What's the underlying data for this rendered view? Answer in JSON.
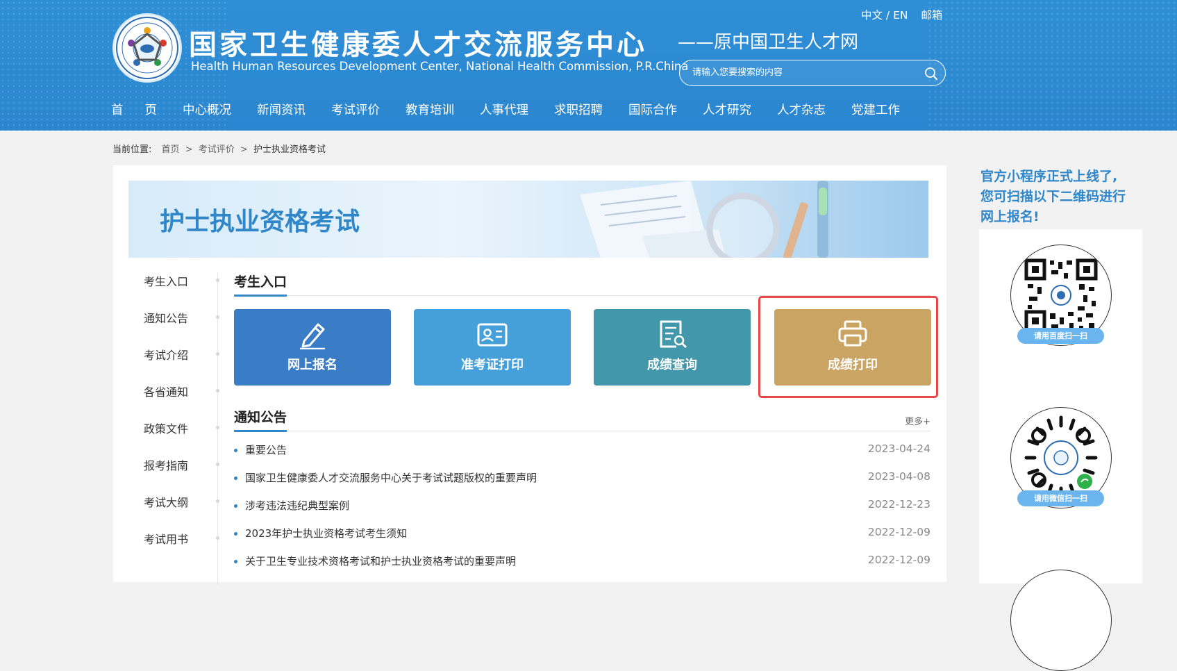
{
  "header": {
    "title": "国家卫生健康委人才交流服务中心",
    "subtitle": "——原中国卫生人才网",
    "english_name": "Health Human Resources Development Center, National Health Commission, P.R.China",
    "lang_switch": "中文 / EN",
    "mail_link": "邮箱",
    "search_placeholder": "请输入您要搜索的内容",
    "icons": {
      "search": "search-icon",
      "logo": "logo-emblem"
    }
  },
  "nav": {
    "items": [
      "首页",
      "中心概况",
      "新闻资讯",
      "考试评价",
      "教育培训",
      "人事代理",
      "求职招聘",
      "国际合作",
      "人才研究",
      "人才杂志",
      "党建工作"
    ]
  },
  "breadcrumb": {
    "label": "当前位置:",
    "items": [
      "首页",
      "考试评价",
      "护士执业资格考试"
    ],
    "separator": ">"
  },
  "banner": {
    "title": "护士执业资格考试"
  },
  "side_menu": {
    "items": [
      "考生入口",
      "通知公告",
      "考试介绍",
      "各省通知",
      "政策文件",
      "报考指南",
      "考试大纲",
      "考试用书"
    ]
  },
  "entry": {
    "section_title": "考生入口",
    "tiles": [
      {
        "label": "网上报名",
        "icon": "pen-edit-icon",
        "color": "#3a7cc6"
      },
      {
        "label": "准考证打印",
        "icon": "id-card-icon",
        "color": "#45a0d9"
      },
      {
        "label": "成绩查询",
        "icon": "document-search-icon",
        "color": "#4397ab"
      },
      {
        "label": "成绩打印",
        "icon": "printer-icon",
        "color": "#c9a463"
      }
    ],
    "highlight_color": "#e64949"
  },
  "notices": {
    "section_title": "通知公告",
    "more": "更多+",
    "items": [
      {
        "title": "重要公告",
        "date": "2023-04-24"
      },
      {
        "title": "国家卫生健康委人才交流服务中心关于考试试题版权的重要声明",
        "date": "2023-04-08"
      },
      {
        "title": "涉考违法违纪典型案例",
        "date": "2022-12-23"
      },
      {
        "title": "2023年护士执业资格考试考生须知",
        "date": "2022-12-09"
      },
      {
        "title": "关于卫生专业技术资格考试和护士执业资格考试的重要声明",
        "date": "2022-12-09"
      }
    ]
  },
  "sidebar_right": {
    "promo_lines": [
      "官方小程序正式上线了,",
      "您可扫描以下二维码进行",
      "网上报名!"
    ],
    "qr_codes": [
      {
        "button": "请用百度扫一扫",
        "icon": "baidu-qr-code"
      },
      {
        "button": "请用微信扫一扫",
        "icon": "wechat-qr-code"
      }
    ]
  },
  "colors": {
    "header_blue": "#2f8fd6",
    "accent_blue": "#2f86c9",
    "page_bg": "#f2f2f2"
  }
}
